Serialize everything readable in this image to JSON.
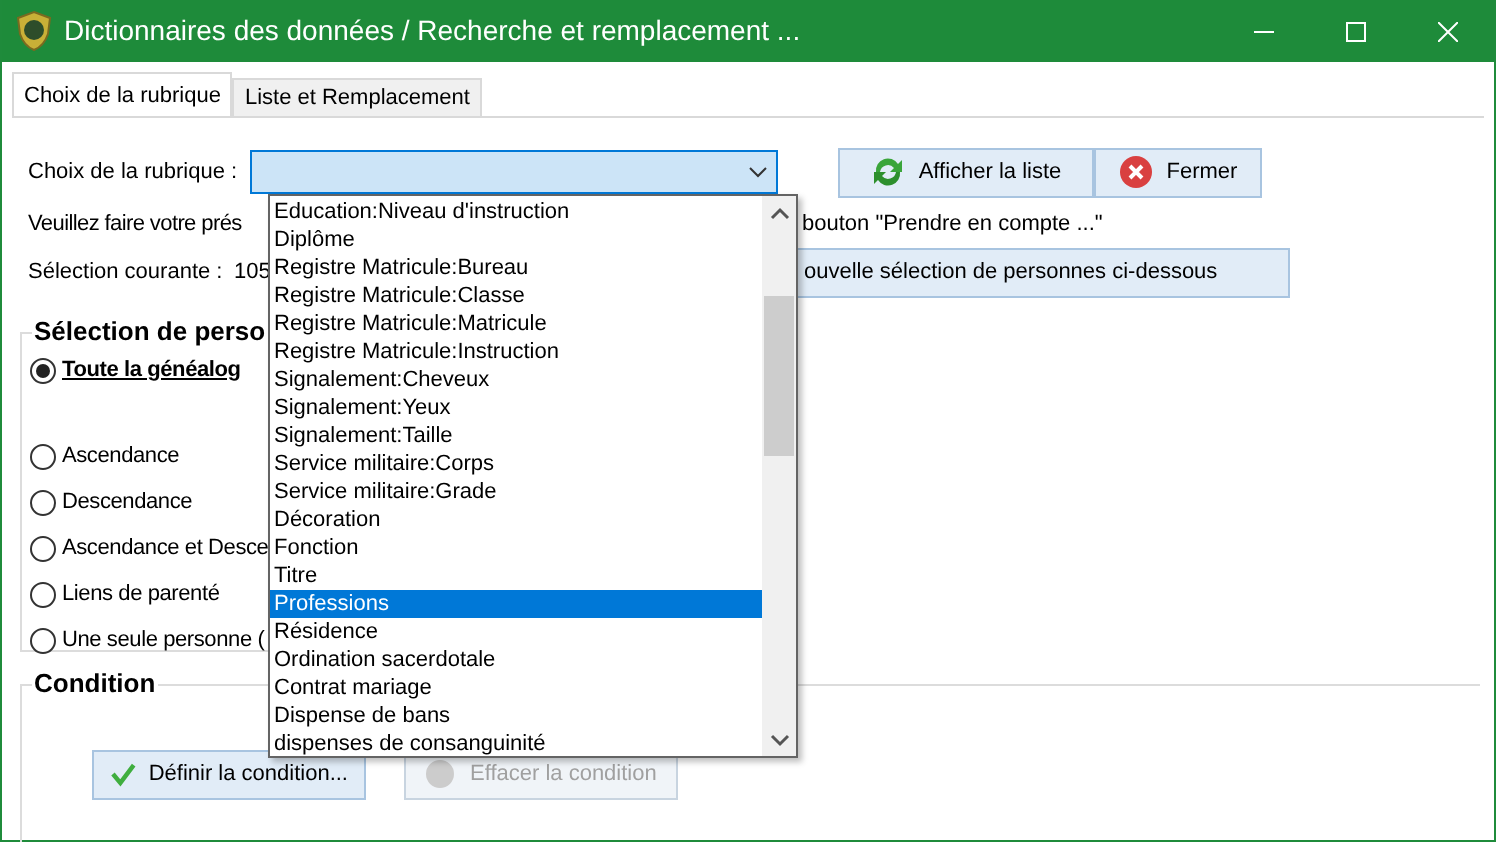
{
  "window": {
    "title": "Dictionnaires des données / Recherche et remplacement ..."
  },
  "tabs": [
    {
      "label": "Choix de la rubrique",
      "selected": true
    },
    {
      "label": "Liste et Remplacement",
      "selected": false
    }
  ],
  "rubrique": {
    "label": "Choix de la rubrique :",
    "dropdown_open": true,
    "options": [
      {
        "label": "Education:Niveau d'instruction",
        "selected": false
      },
      {
        "label": "Diplôme",
        "selected": false
      },
      {
        "label": "Registre Matricule:Bureau",
        "selected": false
      },
      {
        "label": "Registre Matricule:Classe",
        "selected": false
      },
      {
        "label": "Registre Matricule:Matricule",
        "selected": false
      },
      {
        "label": "Registre Matricule:Instruction",
        "selected": false
      },
      {
        "label": "Signalement:Cheveux",
        "selected": false
      },
      {
        "label": "Signalement:Yeux",
        "selected": false
      },
      {
        "label": "Signalement:Taille",
        "selected": false
      },
      {
        "label": "Service militaire:Corps",
        "selected": false
      },
      {
        "label": "Service militaire:Grade",
        "selected": false
      },
      {
        "label": "Décoration",
        "selected": false
      },
      {
        "label": "Fonction",
        "selected": false
      },
      {
        "label": "Titre",
        "selected": false
      },
      {
        "label": "Professions",
        "selected": true
      },
      {
        "label": "Résidence",
        "selected": false
      },
      {
        "label": "Ordination sacerdotale",
        "selected": false
      },
      {
        "label": "Contrat mariage",
        "selected": false
      },
      {
        "label": "Dispense de bans",
        "selected": false
      },
      {
        "label": "dispenses de consanguinité",
        "selected": false
      }
    ]
  },
  "buttons": [
    {
      "label": "Afficher la liste",
      "kind": "refresh"
    },
    {
      "label": "Fermer",
      "kind": "close"
    }
  ],
  "instruction": {
    "left": "Veuillez faire votre prés",
    "right": "bouton \"Prendre en compte ...\""
  },
  "current_selection": {
    "label": "Sélection courante :",
    "value": "105",
    "button": "ouvelle sélection de personnes ci-dessous"
  },
  "selection_group": {
    "title": "Sélection de perso",
    "options": [
      {
        "label": "Toute la généalog",
        "selected": true
      },
      {
        "label": "Ascendance",
        "selected": false
      },
      {
        "label": "Descendance",
        "selected": false
      },
      {
        "label": "Ascendance et Desce",
        "selected": false
      },
      {
        "label": "Liens de parenté",
        "selected": false
      },
      {
        "label": "Une seule personne (",
        "selected": false
      }
    ]
  },
  "condition_group": {
    "title": "Condition",
    "buttons": [
      {
        "label": "Définir la condition...",
        "kind": "check",
        "disabled": false
      },
      {
        "label": "Effacer la condition",
        "kind": "erase",
        "disabled": true
      }
    ]
  }
}
